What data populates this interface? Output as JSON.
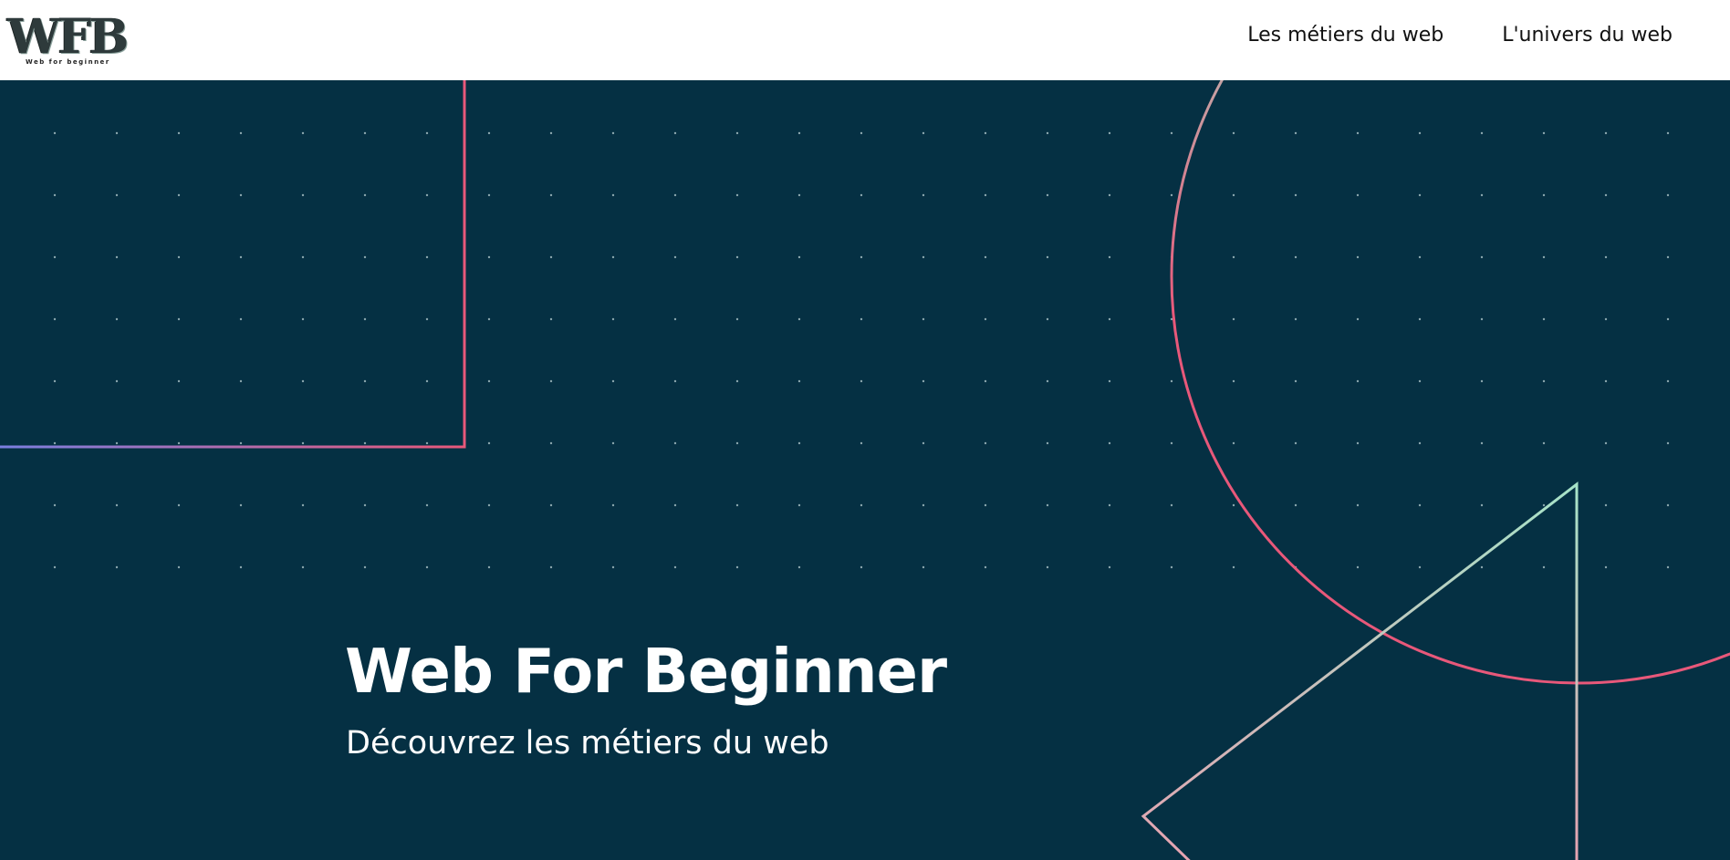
{
  "header": {
    "logo_text": "WFB",
    "logo_tagline": "Web for beginner",
    "nav": [
      {
        "label": "Les métiers du web"
      },
      {
        "label": "L'univers du web"
      }
    ]
  },
  "hero": {
    "title": "Web For Beginner",
    "subtitle": "Découvrez les métiers du web"
  },
  "colors": {
    "hero_background": "#053043",
    "accent_pink": "#e8587a",
    "accent_mint": "#a6e3c8",
    "accent_violet": "#7b7fe0",
    "dot": "#8aa6ad"
  }
}
